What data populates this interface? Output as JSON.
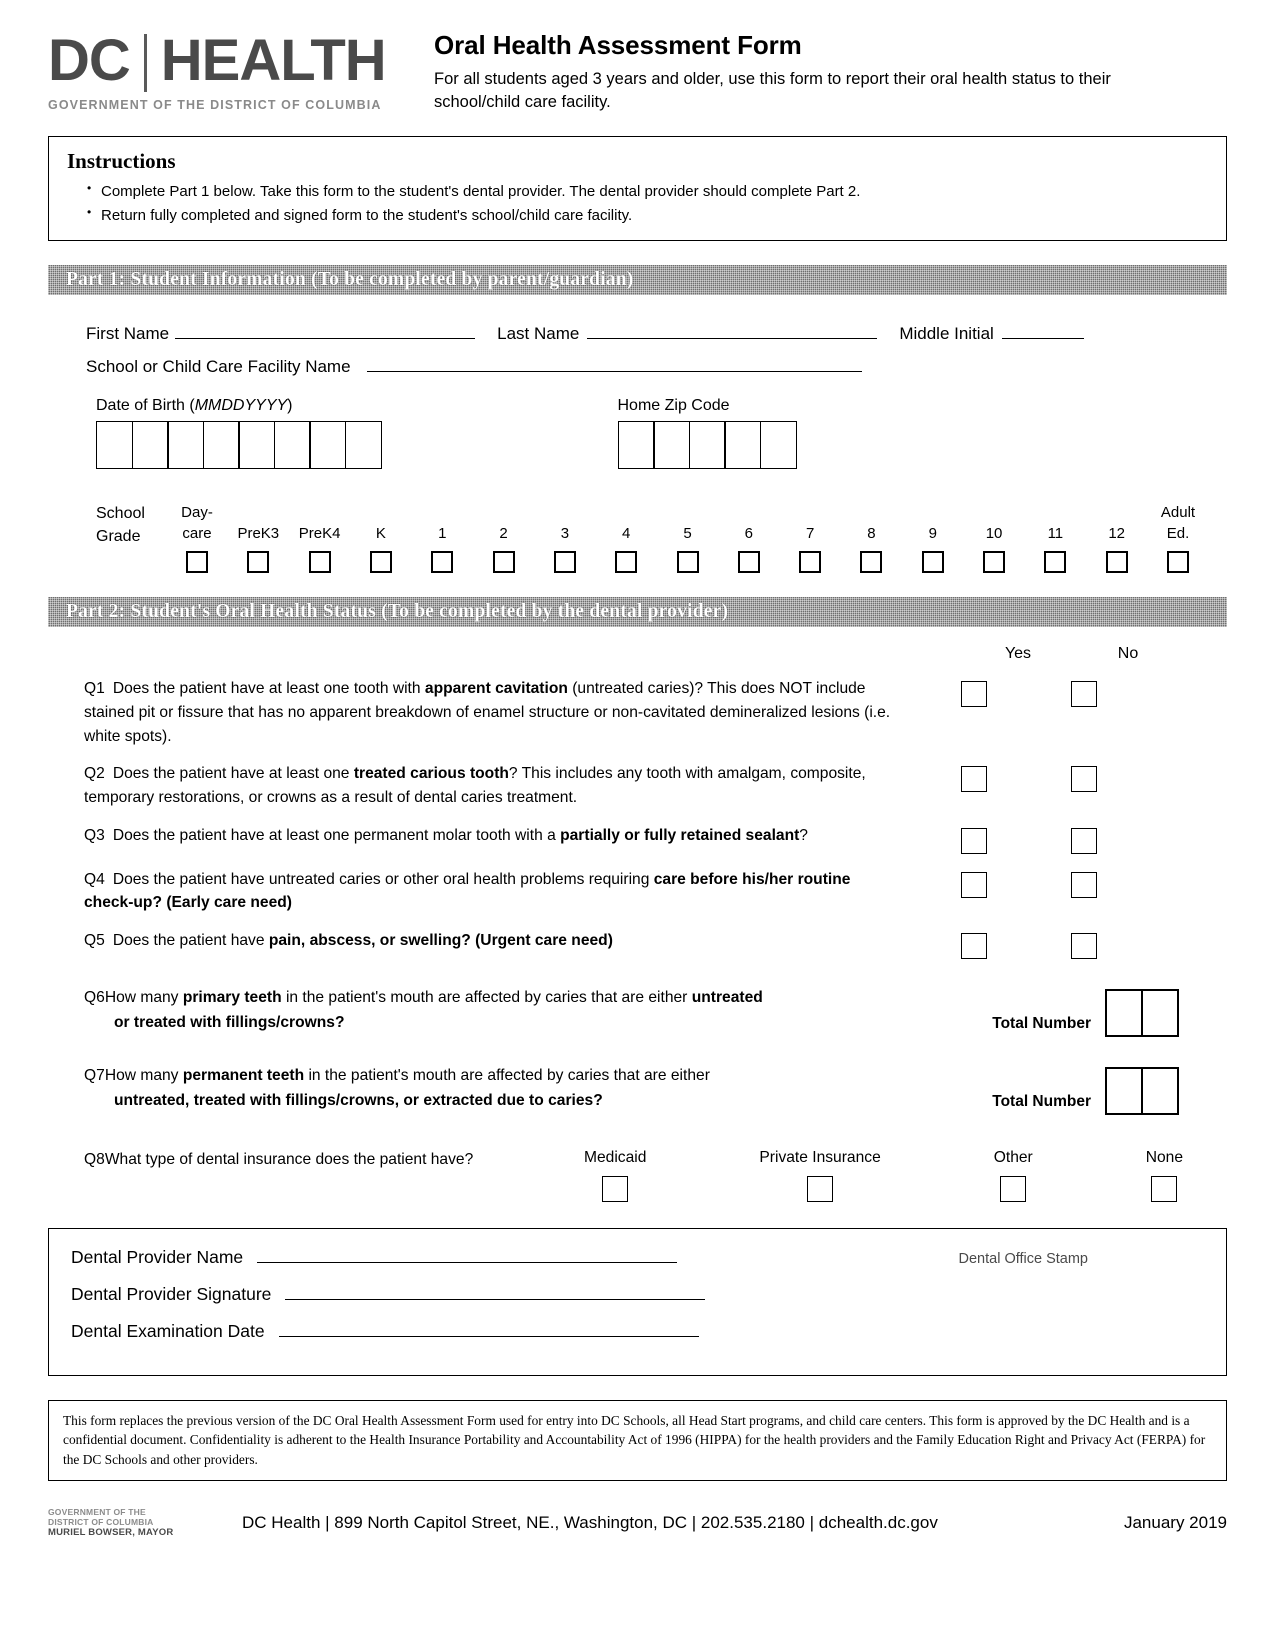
{
  "header": {
    "logo_dc": "DC",
    "logo_health": "HEALTH",
    "logo_sub": "GOVERNMENT OF THE DISTRICT OF COLUMBIA",
    "title": "Oral Health Assessment Form",
    "subtitle": "For all students aged 3 years and older, use this form to report their oral health status to their school/child care facility."
  },
  "instructions": {
    "heading": "Instructions",
    "items": [
      "Complete Part 1 below. Take this form to the student's dental provider. The dental provider should complete Part 2.",
      "Return fully completed and signed form to the student's school/child care facility."
    ]
  },
  "part1": {
    "bar_title": "Part 1: Student Information (To be completed by parent/guardian)",
    "first_name_label": "First Name",
    "last_name_label": "Last Name",
    "middle_initial_label": "Middle Initial",
    "school_label": "School or Child Care Facility Name",
    "dob_label_text": "Date of Birth (",
    "dob_label_italic": "MMDDYYYY",
    "dob_label_close": ")",
    "dob_cells": 8,
    "zip_label": "Home Zip Code",
    "zip_cells": 5,
    "grade_title_line1": "School",
    "grade_title_line2": "Grade",
    "grades": [
      "Day-\ncare",
      "PreK3",
      "PreK4",
      "K",
      "1",
      "2",
      "3",
      "4",
      "5",
      "6",
      "7",
      "8",
      "9",
      "10",
      "11",
      "12",
      "Adult\nEd."
    ]
  },
  "part2": {
    "bar_title": "Part 2: Student's Oral Health Status (To be completed by the dental provider)",
    "yes_label": "Yes",
    "no_label": "No",
    "questions": [
      {
        "num": "Q1",
        "segments": [
          {
            "t": "Does the patient have at least one tooth with ",
            "b": false
          },
          {
            "t": "apparent cavitation",
            "b": true
          },
          {
            "t": " (untreated caries)? This does NOT include stained pit or fissure that has no apparent breakdown of enamel structure or non-cavitated demineralized lesions (i.e. white spots).",
            "b": false
          }
        ]
      },
      {
        "num": "Q2",
        "segments": [
          {
            "t": "Does the patient have at least one ",
            "b": false
          },
          {
            "t": "treated carious tooth",
            "b": true
          },
          {
            "t": "? This includes any tooth with amalgam, composite, temporary restorations, or crowns as a result of dental caries treatment.",
            "b": false
          }
        ]
      },
      {
        "num": "Q3",
        "segments": [
          {
            "t": "Does the patient have at least one permanent molar tooth with a ",
            "b": false
          },
          {
            "t": "partially or fully retained sealant",
            "b": true
          },
          {
            "t": "?",
            "b": false
          }
        ]
      },
      {
        "num": "Q4",
        "segments": [
          {
            "t": "Does the patient have untreated caries or other oral health problems requiring ",
            "b": false
          },
          {
            "t": "care before his/her routine check-up? (Early care need)",
            "b": true
          }
        ]
      },
      {
        "num": "Q5",
        "segments": [
          {
            "t": "Does the patient have ",
            "b": false
          },
          {
            "t": "pain, abscess, or swelling? (Urgent care need)",
            "b": true
          }
        ]
      }
    ],
    "totals": [
      {
        "num": "Q6",
        "line1_segments": [
          {
            "t": "How many ",
            "b": false
          },
          {
            "t": "primary teeth",
            "b": true
          },
          {
            "t": " in the patient's mouth are affected by caries that are either ",
            "b": false
          },
          {
            "t": "untreated",
            "b": true
          }
        ],
        "line2_segments": [
          {
            "t": "or treated with fillings/crowns?",
            "b": true
          }
        ],
        "total_label": "Total Number",
        "cells": 2
      },
      {
        "num": "Q7",
        "line1_segments": [
          {
            "t": "How many ",
            "b": false
          },
          {
            "t": "permanent teeth",
            "b": true
          },
          {
            "t": " in the patient's mouth are affected by caries that are either",
            "b": false
          }
        ],
        "line2_segments": [
          {
            "t": "untreated, treated with fillings/crowns, or extracted due to caries?",
            "b": true
          }
        ],
        "total_label": "Total Number",
        "cells": 2
      }
    ],
    "q8": {
      "num": "Q8",
      "text": "What type of dental insurance does the patient have?",
      "options": [
        "Medicaid",
        "Private Insurance",
        "Other",
        "None"
      ]
    }
  },
  "provider": {
    "name_label": "Dental Provider Name",
    "signature_label": "Dental Provider Signature",
    "exam_date_label": "Dental Examination Date",
    "stamp_label": "Dental Office Stamp"
  },
  "disclaimer": "This form replaces the previous version of the DC Oral Health Assessment Form used for entry into DC Schools, all Head Start programs, and child care centers. This form is approved by the DC Health and is a confidential document. Confidentiality is adherent to the Health Insurance Portability and Accountability Act of 1996 (HIPPA) for the health providers and the Family Education Right and Privacy Act (FERPA) for the DC Schools and other providers.",
  "footer": {
    "seal_line1": "GOVERNMENT OF THE",
    "seal_line2": "DISTRICT OF COLUMBIA",
    "seal_line3": "MURIEL BOWSER, MAYOR",
    "contact": "DC Health | 899 North Capitol Street, NE., Washington, DC | 202.535.2180 | dchealth.dc.gov",
    "date": "January 2019"
  }
}
